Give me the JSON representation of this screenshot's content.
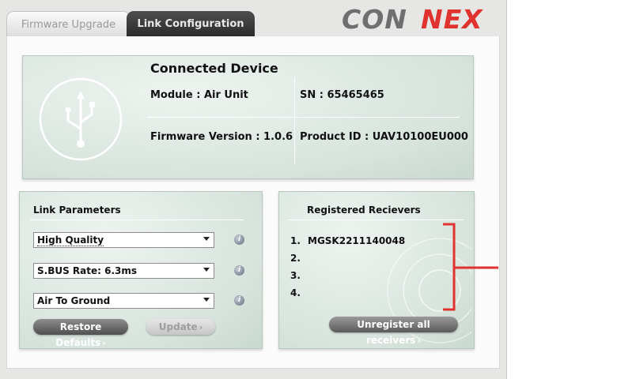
{
  "tabs": [
    {
      "label": "Firmware Upgrade",
      "active": false
    },
    {
      "label": "Link Configuration",
      "active": true
    }
  ],
  "logo": {
    "text_con": "CON",
    "text_nex": "NEX",
    "color_con": "#6f6f6f",
    "color_nex": "#e0322e"
  },
  "device": {
    "title": "Connected Device",
    "module": "Module : Air Unit",
    "sn": "SN : 65465465",
    "firmware": "Firmware Version : 1.0.6",
    "product_id": "Product ID : UAV10100EU000",
    "icon": "usb-icon"
  },
  "link_parameters": {
    "title": "Link Parameters",
    "selects": [
      {
        "value": "High Quality"
      },
      {
        "value": "S.BUS Rate: 6.3ms"
      },
      {
        "value": "Air To Ground"
      }
    ],
    "info_icon": "i",
    "restore_label": "Restore Defaults",
    "update_label": "Update"
  },
  "receivers": {
    "title": "Registered Recievers",
    "items": [
      {
        "num": "1.",
        "value": "MGSK2211140048"
      },
      {
        "num": "2.",
        "value": ""
      },
      {
        "num": "3.",
        "value": ""
      },
      {
        "num": "4.",
        "value": ""
      }
    ],
    "unregister_label": "Unregister all receivers"
  },
  "colors": {
    "accent_red": "#e0322e",
    "panel_green": "#d7e3dc",
    "tab_dark": "#2f2f2f"
  }
}
